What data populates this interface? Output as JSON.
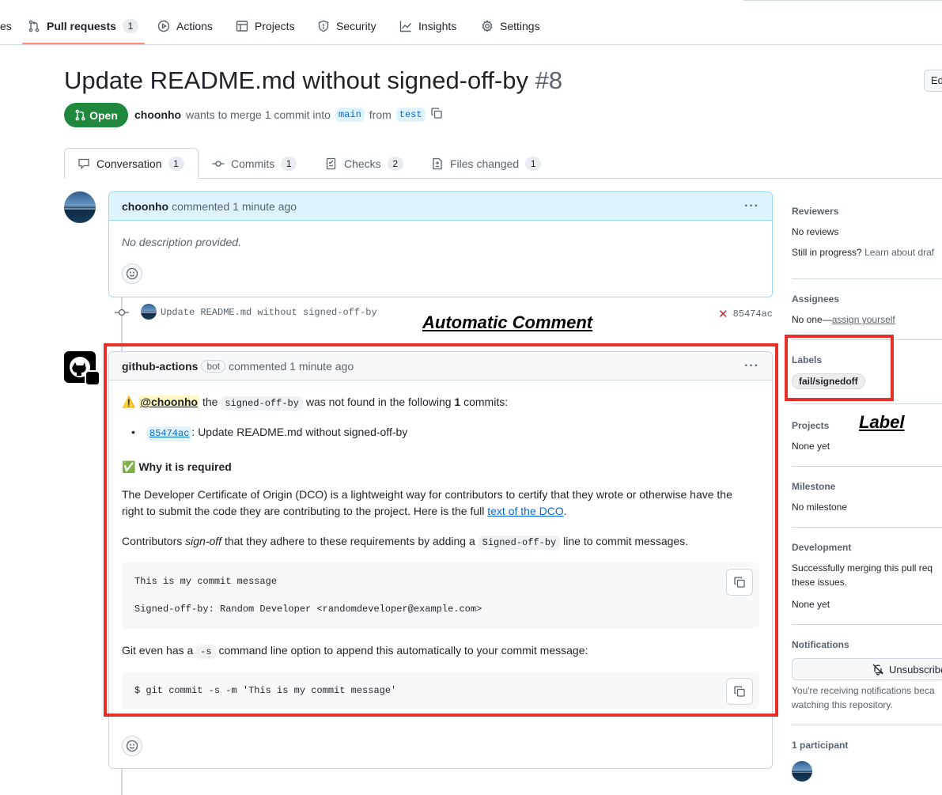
{
  "nav": {
    "partial_left": "es",
    "items": [
      {
        "label": "Pull requests",
        "count": "1"
      },
      {
        "label": "Actions"
      },
      {
        "label": "Projects"
      },
      {
        "label": "Security"
      },
      {
        "label": "Insights"
      },
      {
        "label": "Settings"
      }
    ]
  },
  "pr": {
    "title": "Update README.md without signed-off-by",
    "number": "#8",
    "edit_label": "Edit",
    "state": "Open",
    "author": "choonho",
    "merge_text": "wants to merge 1 commit into",
    "base_branch": "main",
    "from_text": "from",
    "head_branch": "test"
  },
  "tabs": [
    {
      "label": "Conversation",
      "count": "1"
    },
    {
      "label": "Commits",
      "count": "1"
    },
    {
      "label": "Checks",
      "count": "2"
    },
    {
      "label": "Files changed",
      "count": "1"
    }
  ],
  "first_comment": {
    "author": "choonho",
    "action": "commented 1 minute ago",
    "body": "No description provided."
  },
  "commit_event": {
    "message": "Update README.md without signed-off-by",
    "sha": "85474ac",
    "status": "✕"
  },
  "bot_comment": {
    "author": "github-actions",
    "badge": "bot",
    "action": "commented 1 minute ago",
    "warn_emoji": "⚠️",
    "mention": "@choonho",
    "line1_a": "the",
    "line1_code": "signed-off-by",
    "line1_b": "was not found in the following",
    "line1_count": "1",
    "line1_c": "commits:",
    "commit_sha": "85474ac",
    "commit_msg": ": Update README.md without signed-off-by",
    "why_emoji": "✅",
    "why_heading": "Why it is required",
    "para1_a": "The Developer Certificate of Origin (DCO) is a lightweight way for contributors to certify that they wrote or otherwise have the right to submit the code they are contributing to the project. Here is the full",
    "para1_link": "text of the DCO",
    "para1_end": ".",
    "para2_a": "Contributors",
    "para2_em": "sign-off",
    "para2_b": "that they adhere to these requirements by adding a",
    "para2_code": "Signed-off-by",
    "para2_c": "line to commit messages.",
    "code1_line1": "This is my commit message",
    "code1_line2": "Signed-off-by: Random Developer <randomdeveloper@example.com>",
    "para3_a": "Git even has a",
    "para3_code": "-s",
    "para3_b": "command line option to append this automatically to your commit message:",
    "code2": "$ git commit -s -m 'This is my commit message'"
  },
  "annotations": {
    "comment": "Automatic Comment",
    "label": "Label",
    "box_color": "#e8302a"
  },
  "sidebar": {
    "reviewers": {
      "heading": "Reviewers",
      "line1": "No reviews",
      "line2": "Still in progress?",
      "link": "Learn about draf"
    },
    "assignees": {
      "heading": "Assignees",
      "text": "No one—",
      "link": "assign yourself"
    },
    "labels": {
      "heading": "Labels",
      "pill": "fail/signedoff"
    },
    "projects": {
      "heading": "Projects",
      "text": "None yet"
    },
    "milestone": {
      "heading": "Milestone",
      "text": "No milestone"
    },
    "development": {
      "heading": "Development",
      "line1": "Successfully merging this pull req",
      "line2": "these issues.",
      "line3": "None yet"
    },
    "notifications": {
      "heading": "Notifications",
      "button": "Unsubscribe",
      "line1": "You're receiving notifications beca",
      "line2": "watching this repository."
    },
    "participants": {
      "heading": "1 participant"
    }
  },
  "colors": {
    "open_green": "#1f883d",
    "accent_blue": "#0969da",
    "nav_underline": "#fd8c73"
  }
}
